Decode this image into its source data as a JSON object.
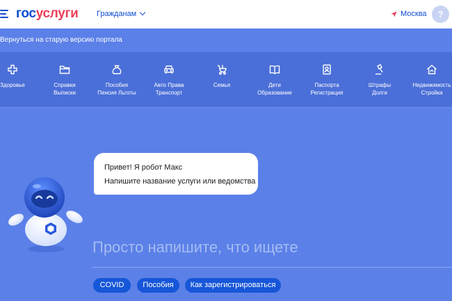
{
  "header": {
    "logo_part1": "гос",
    "logo_part2": "услуги",
    "audience": "Гражданам",
    "location": "Москва",
    "help": "?"
  },
  "back_link": "Вернуться на старую версию портала",
  "categories": [
    {
      "icon": "plus-icon",
      "line1": "Здоровье",
      "line2": ""
    },
    {
      "icon": "folder-icon",
      "line1": "Справки",
      "line2": "Выписки"
    },
    {
      "icon": "money-bag-icon",
      "line1": "Пособия",
      "line2": "Пенсия Льготы"
    },
    {
      "icon": "car-icon",
      "line1": "Авто Права",
      "line2": "Транспорт"
    },
    {
      "icon": "stroller-icon",
      "line1": "Семья",
      "line2": ""
    },
    {
      "icon": "book-icon",
      "line1": "Дети",
      "line2": "Образование"
    },
    {
      "icon": "passport-icon",
      "line1": "Паспорта",
      "line2": "Регистрация"
    },
    {
      "icon": "gavel-icon",
      "line1": "Штрафы",
      "line2": "Долги"
    },
    {
      "icon": "house-icon",
      "line1": "Недвижимость",
      "line2": "Стройка"
    }
  ],
  "assistant": {
    "greeting": "Привет! Я робот Макс",
    "prompt": "Напишите название услуги или ведомства"
  },
  "search": {
    "placeholder": "Просто напишите, что ищете"
  },
  "chips": [
    "COVID",
    "Пособия",
    "Как зарегистрироваться"
  ],
  "colors": {
    "brand_blue": "#0d4cd3",
    "brand_red": "#ee3f58",
    "hero_bg": "#5b80e8",
    "chip_bg": "#1656d8"
  }
}
